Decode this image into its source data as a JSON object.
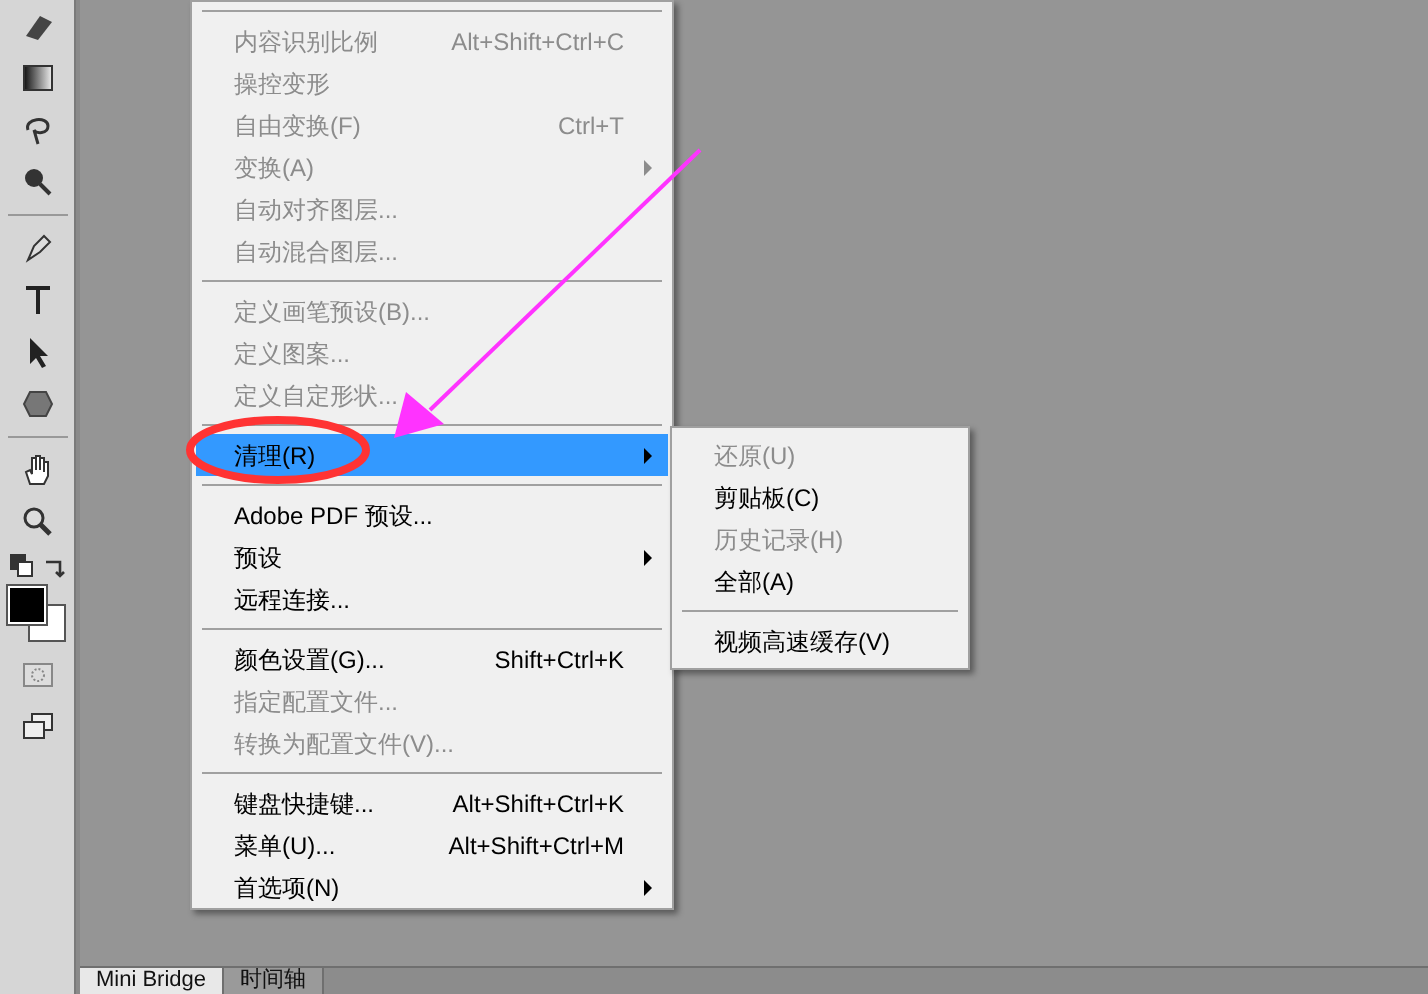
{
  "toolbar": {
    "tools": [
      {
        "kind": "eraser"
      },
      {
        "kind": "gradient"
      },
      {
        "kind": "lasso"
      },
      {
        "kind": "quick-select"
      },
      {
        "kind": "separator"
      },
      {
        "kind": "pen"
      },
      {
        "kind": "type"
      },
      {
        "kind": "arrow"
      },
      {
        "kind": "shape"
      },
      {
        "kind": "separator"
      },
      {
        "kind": "hand"
      },
      {
        "kind": "zoom"
      },
      {
        "kind": "swap"
      },
      {
        "kind": "colors"
      },
      {
        "kind": "mask"
      },
      {
        "kind": "screen"
      }
    ]
  },
  "menu": {
    "items": [
      {
        "kind": "separator"
      },
      {
        "kind": "item",
        "label": "内容识别比例",
        "shortcut": "Alt+Shift+Ctrl+C",
        "disabled": true,
        "selected": false,
        "submenu": false
      },
      {
        "kind": "item",
        "label": "操控变形",
        "disabled": true,
        "selected": false,
        "submenu": false
      },
      {
        "kind": "item",
        "label": "自由变换(F)",
        "shortcut": "Ctrl+T",
        "disabled": true,
        "selected": false,
        "submenu": false
      },
      {
        "kind": "item",
        "label": "变换(A)",
        "disabled": true,
        "selected": false,
        "submenu": true
      },
      {
        "kind": "item",
        "label": "自动对齐图层...",
        "disabled": true,
        "selected": false,
        "submenu": false
      },
      {
        "kind": "item",
        "label": "自动混合图层...",
        "disabled": true,
        "selected": false,
        "submenu": false
      },
      {
        "kind": "separator"
      },
      {
        "kind": "item",
        "label": "定义画笔预设(B)...",
        "disabled": true,
        "selected": false,
        "submenu": false
      },
      {
        "kind": "item",
        "label": "定义图案...",
        "disabled": true,
        "selected": false,
        "submenu": false
      },
      {
        "kind": "item",
        "label": "定义自定形状...",
        "disabled": true,
        "selected": false,
        "submenu": false
      },
      {
        "kind": "separator"
      },
      {
        "kind": "item",
        "label": "清理(R)",
        "disabled": false,
        "selected": true,
        "submenu": true
      },
      {
        "kind": "separator"
      },
      {
        "kind": "item",
        "label": "Adobe PDF 预设...",
        "disabled": false,
        "selected": false,
        "submenu": false
      },
      {
        "kind": "item",
        "label": "预设",
        "disabled": false,
        "selected": false,
        "submenu": true
      },
      {
        "kind": "item",
        "label": "远程连接...",
        "disabled": false,
        "selected": false,
        "submenu": false
      },
      {
        "kind": "separator"
      },
      {
        "kind": "item",
        "label": "颜色设置(G)...",
        "shortcut": "Shift+Ctrl+K",
        "disabled": false,
        "selected": false,
        "submenu": false
      },
      {
        "kind": "item",
        "label": "指定配置文件...",
        "disabled": true,
        "selected": false,
        "submenu": false
      },
      {
        "kind": "item",
        "label": "转换为配置文件(V)...",
        "disabled": true,
        "selected": false,
        "submenu": false
      },
      {
        "kind": "separator"
      },
      {
        "kind": "item",
        "label": "键盘快捷键...",
        "shortcut": "Alt+Shift+Ctrl+K",
        "disabled": false,
        "selected": false,
        "submenu": false
      },
      {
        "kind": "item",
        "label": "菜单(U)...",
        "shortcut": "Alt+Shift+Ctrl+M",
        "disabled": false,
        "selected": false,
        "submenu": false
      },
      {
        "kind": "item",
        "label": "首选项(N)",
        "disabled": false,
        "selected": false,
        "submenu": true
      }
    ]
  },
  "submenu": {
    "items": [
      {
        "kind": "item",
        "label": "还原(U)",
        "disabled": true
      },
      {
        "kind": "item",
        "label": "剪贴板(C)",
        "disabled": false
      },
      {
        "kind": "item",
        "label": "历史记录(H)",
        "disabled": true
      },
      {
        "kind": "item",
        "label": "全部(A)",
        "disabled": false
      },
      {
        "kind": "separator"
      },
      {
        "kind": "item",
        "label": "视频高速缓存(V)",
        "disabled": false
      }
    ]
  },
  "panel_tabs": [
    {
      "label": "Mini Bridge",
      "selected": true
    },
    {
      "label": "时间轴",
      "selected": false
    }
  ]
}
